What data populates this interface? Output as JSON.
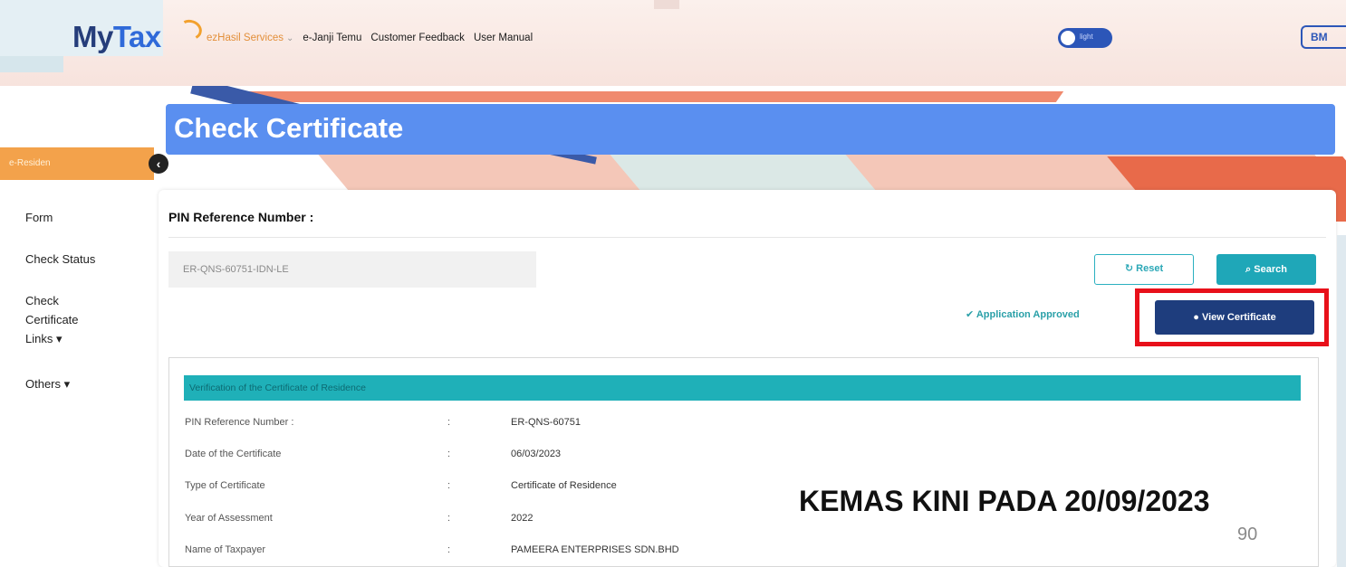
{
  "header": {
    "logo_my": "My",
    "logo_tax": "Tax",
    "nav": [
      {
        "label": "ezHasil Services"
      },
      {
        "label": "e-Janji Temu"
      },
      {
        "label": "Customer Feedback"
      },
      {
        "label": "User Manual"
      }
    ],
    "theme_toggle_label": "light",
    "language_button": "BM"
  },
  "page": {
    "title": "Check Certificate"
  },
  "sidebar": {
    "active_item": "e-Residen",
    "items": [
      {
        "label": "Form"
      },
      {
        "label": "Check Status"
      },
      {
        "label": "Check"
      },
      {
        "label": "Certificate"
      },
      {
        "label": "Links ▾"
      },
      {
        "label": "Others ▾"
      }
    ]
  },
  "form": {
    "pin_label": "PIN Reference Number :",
    "pin_value": "ER-QNS-60751-IDN-LE",
    "reset_label": "↻ Reset",
    "search_label": "⌕ Search",
    "status_text": "✔ Application Approved",
    "view_certificate_label": "● View Certificate"
  },
  "verification": {
    "heading": "Verification of the Certificate of Residence",
    "rows": [
      {
        "label": "PIN Reference Number :",
        "sep": ":",
        "value": "ER-QNS-60751"
      },
      {
        "label": "Date of the Certificate",
        "sep": ":",
        "value": "06/03/2023"
      },
      {
        "label": "Type of Certificate",
        "sep": ":",
        "value": "Certificate of Residence"
      },
      {
        "label": "Year of Assessment",
        "sep": ":",
        "value": "2022"
      },
      {
        "label": "Name of Taxpayer",
        "sep": ":",
        "value": "PAMEERA ENTERPRISES SDN.BHD"
      }
    ]
  },
  "overlay": {
    "update_note": "KEMAS KINI PADA 20/09/2023",
    "page_number": "90"
  },
  "colors": {
    "brand_blue": "#253d7a",
    "accent_teal": "#1fa7b8",
    "highlight_red": "#e8101a",
    "sidebar_orange": "#f3a24b"
  }
}
